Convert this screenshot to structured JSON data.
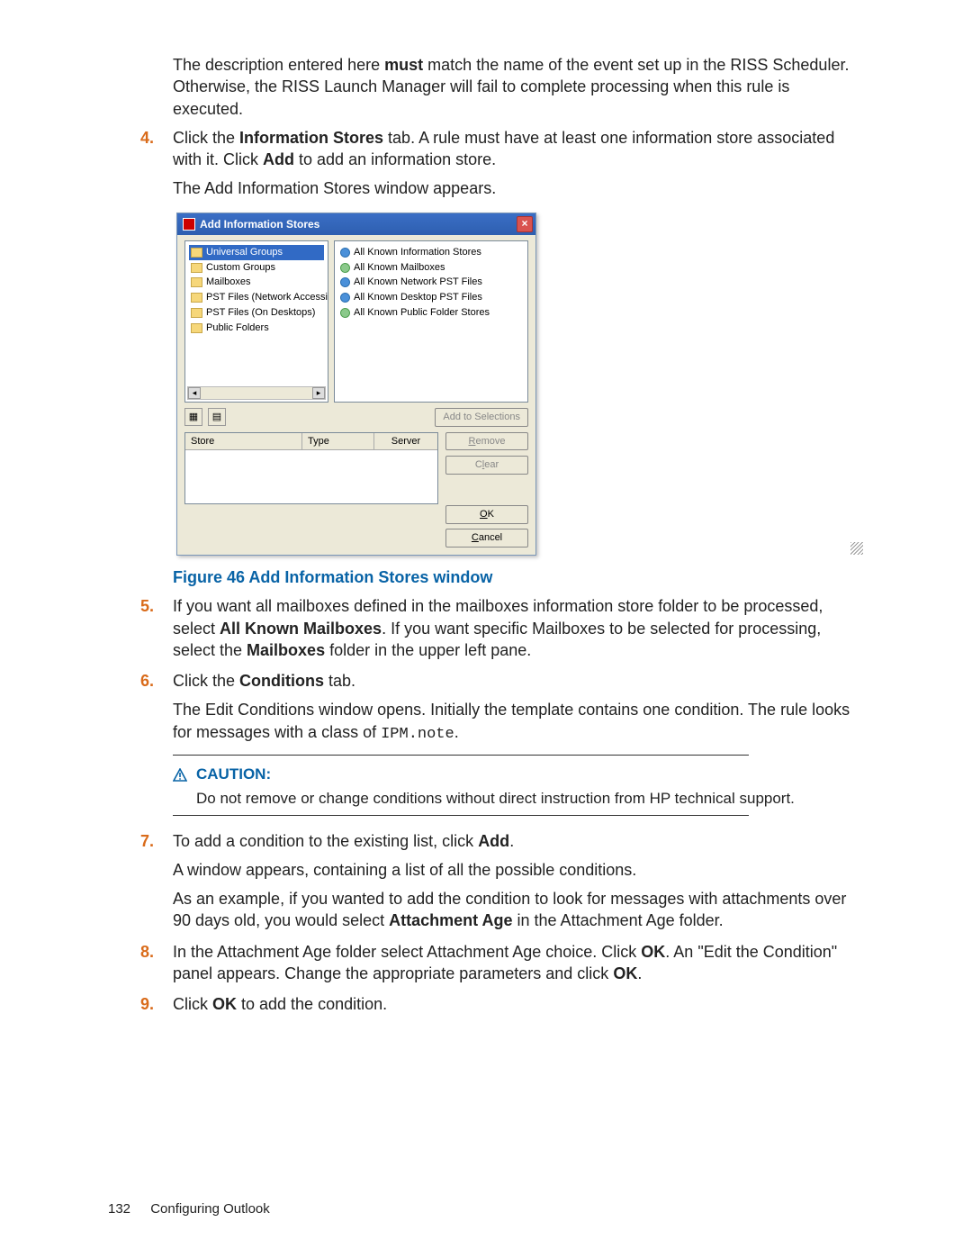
{
  "intro": {
    "p1a": "The description entered here ",
    "must": "must",
    "p1b": " match the name of the event set up in the RISS Scheduler. Otherwise, the RISS Launch Manager will fail to complete processing when this rule is executed."
  },
  "steps": {
    "s4": {
      "num": "4.",
      "t1": "Click the ",
      "b1": "Information Stores",
      "t2": " tab. A rule must have at least one information store associated with it. Click ",
      "b2": "Add",
      "t3": " to add an information store.",
      "p2": "The Add Information Stores window appears."
    },
    "s5": {
      "num": "5.",
      "t1": "If you want all mailboxes defined in the mailboxes information store folder to be processed, select ",
      "b1": "All Known Mailboxes",
      "t2": ". If you want specific Mailboxes to be selected for processing, select the ",
      "b2": "Mailboxes",
      "t3": " folder in the upper left pane."
    },
    "s6": {
      "num": "6.",
      "t1": "Click the ",
      "b1": "Conditions",
      "t2": " tab.",
      "p2a": "The Edit Conditions window opens. Initially the template contains one condition. The rule looks for messages with a class of ",
      "code": "IPM.note",
      "p2b": "."
    },
    "s7": {
      "num": "7.",
      "t1": "To add a condition to the existing list, click ",
      "b1": "Add",
      "t2": ".",
      "p2": "A window appears, containing a list of all the possible conditions.",
      "p3a": "As an example, if you wanted to add the condition to look for messages with attachments over 90 days old, you would select ",
      "b2": "Attachment Age",
      "p3b": " in the Attachment Age folder."
    },
    "s8": {
      "num": "8.",
      "t1": "In the Attachment Age folder select Attachment Age choice. Click ",
      "b1": "OK",
      "t2": ". An \"Edit the Condition\" panel appears. Change the appropriate parameters and click ",
      "b2": "OK",
      "t3": "."
    },
    "s9": {
      "num": "9.",
      "t1": "Click ",
      "b1": "OK",
      "t2": " to add the condition."
    }
  },
  "figcap": "Figure 46 Add Information Stores window",
  "caution": {
    "label": "CAUTION:",
    "text": "Do not remove or change conditions without direct instruction from HP technical support."
  },
  "footer": {
    "page": "132",
    "chapter": "Configuring Outlook"
  },
  "dialog": {
    "title": "Add Information Stores",
    "left": [
      "Universal Groups",
      "Custom Groups",
      "Mailboxes",
      "PST Files (Network Accessible)",
      "PST Files (On Desktops)",
      "Public Folders"
    ],
    "right": [
      "All Known Information Stores",
      "All Known Mailboxes",
      "All Known Network PST Files",
      "All Known Desktop PST Files",
      "All Known Public Folder Stores"
    ],
    "buttons": {
      "add": "Add to Selections",
      "remove": "Remove",
      "clear": "Clear",
      "ok": "OK",
      "cancel": "Cancel"
    },
    "grid": {
      "store": "Store",
      "type": "Type",
      "server": "Server"
    }
  }
}
